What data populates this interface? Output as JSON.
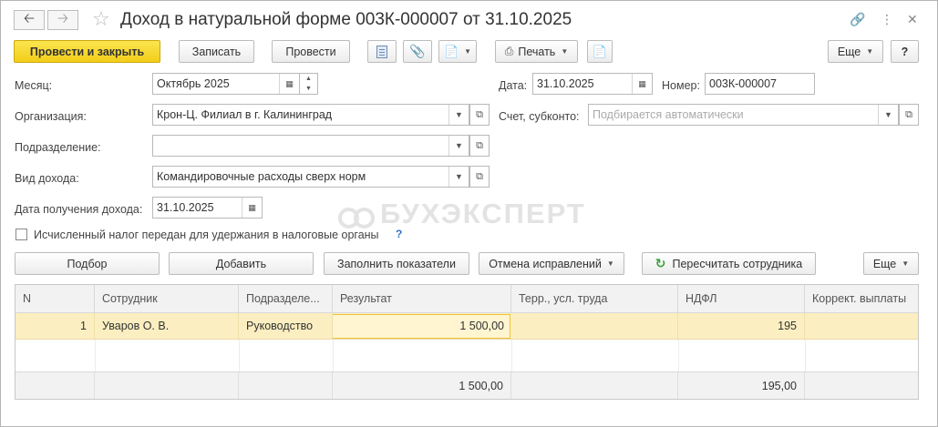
{
  "window": {
    "title": "Доход в натуральной форме 003К-000007 от 31.10.2025"
  },
  "icons": {
    "back": "arrow-left-icon",
    "forward": "arrow-right-icon",
    "favorite": "star-icon",
    "link": "link-icon",
    "menu": "more-vertical-icon",
    "close": "close-icon"
  },
  "toolbar": {
    "post_and_close": "Провести и закрыть",
    "save": "Записать",
    "post": "Провести",
    "print": "Печать",
    "more": "Еще",
    "help": "?"
  },
  "form": {
    "month_label": "Месяц:",
    "month_value": "Октябрь 2025",
    "date_label": "Дата:",
    "date_value": "31.10.2025",
    "number_label": "Номер:",
    "number_value": "003К-000007",
    "org_label": "Организация:",
    "org_value": "Крон-Ц. Филиал в г. Калининград",
    "account_label": "Счет, субконто:",
    "account_placeholder": "Подбирается автоматически",
    "dept_label": "Подразделение:",
    "dept_value": "",
    "income_type_label": "Вид дохода:",
    "income_type_value": "Командировочные расходы сверх норм",
    "income_date_label": "Дата получения дохода:",
    "income_date_value": "31.10.2025",
    "tax_checkbox_label": "Исчисленный налог передан для удержания в налоговые органы",
    "tax_checkbox_checked": false,
    "help_mark": "?"
  },
  "watermark": {
    "text": "БУХЭКСПЕРТ"
  },
  "table_toolbar": {
    "select": "Подбор",
    "add": "Добавить",
    "fill": "Заполнить показатели",
    "cancel_corrections": "Отмена исправлений",
    "recalc": "Пересчитать сотрудника",
    "more": "Еще"
  },
  "table": {
    "columns": [
      "N",
      "Сотрудник",
      "Подразделе...",
      "Результат",
      "Терр., усл. труда",
      "НДФЛ",
      "Коррект. выплаты"
    ],
    "rows": [
      {
        "n": "1",
        "employee": "Уваров О. В.",
        "dept": "Руководство",
        "result": "1 500,00",
        "terr": "",
        "ndfl": "195",
        "corr": ""
      }
    ],
    "totals": {
      "result": "1 500,00",
      "ndfl": "195,00"
    }
  },
  "colors": {
    "primary_button": "#f2cd1a",
    "selected_row": "#fbeec0",
    "help_blue": "#3572c4",
    "recalc_green": "#3aa03a"
  }
}
